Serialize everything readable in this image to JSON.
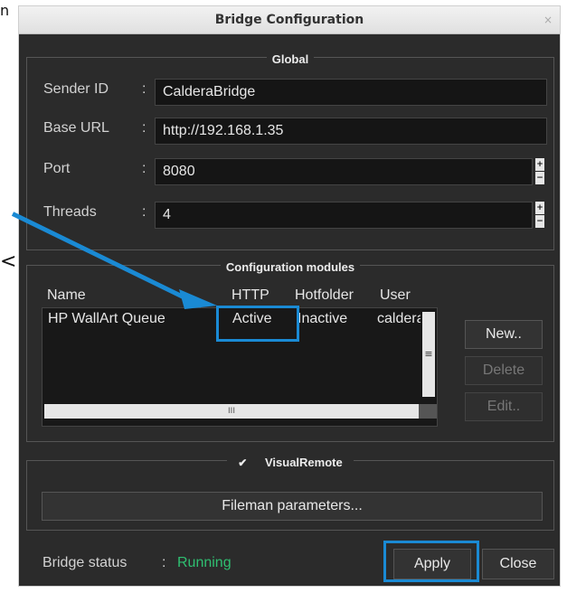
{
  "page": {
    "edge_fragments": [
      "n",
      "<"
    ]
  },
  "dialog": {
    "title": "Bridge Configuration",
    "close_label": "×",
    "global": {
      "legend": "Global",
      "fields": [
        {
          "label": "Sender ID",
          "sep": ":",
          "value": "CalderaBridge"
        },
        {
          "label": "Base URL",
          "sep": ":",
          "value": "http://192.168.1.35"
        },
        {
          "label": "Port",
          "sep": ":",
          "value": "8080"
        },
        {
          "label": "Threads",
          "sep": ":",
          "value": "4"
        }
      ],
      "spin_up": "+",
      "spin_down": "−"
    },
    "modules": {
      "legend": "Configuration modules",
      "columns": [
        "Name",
        "HTTP",
        "Hotfolder",
        "User"
      ],
      "rows": [
        {
          "name": "HP WallArt Queue",
          "http": "Active",
          "hotfolder": "Inactive",
          "user": "caldera"
        }
      ],
      "vscroll_grip": "≡",
      "hscroll_grip": "III",
      "buttons": {
        "new": "New..",
        "delete": "Delete",
        "edit": "Edit.."
      }
    },
    "visualremote": {
      "checkbox_glyph": "✔",
      "checked": true,
      "legend": "VisualRemote",
      "fileman_button": "Fileman parameters..."
    },
    "status": {
      "label": "Bridge status",
      "sep": ":",
      "value": "Running",
      "value_color": "#2fbf71"
    },
    "footer": {
      "apply": "Apply",
      "close": "Close"
    }
  },
  "annotation_color": "#1a8ad4"
}
